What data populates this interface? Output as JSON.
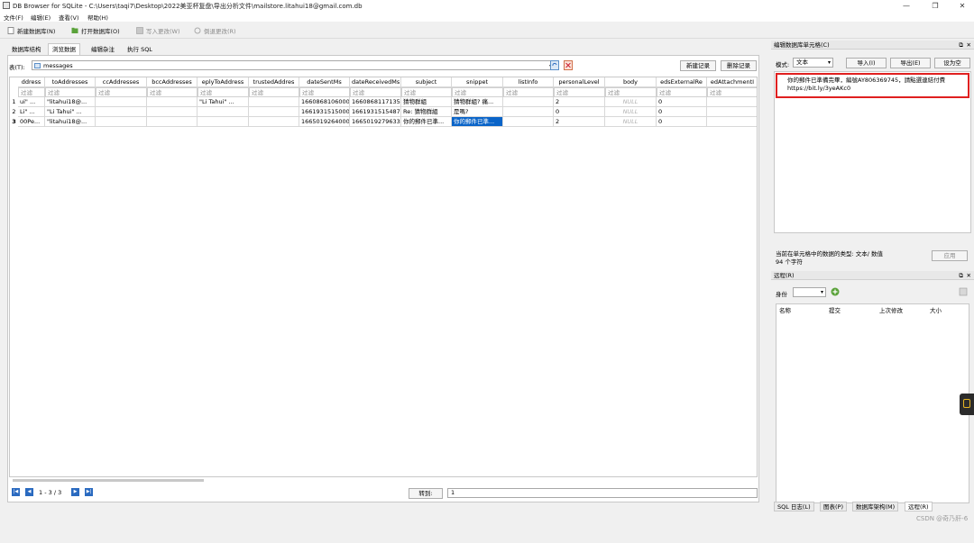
{
  "window": {
    "title": "DB Browser for SQLite - C:\\Users\\taqi7\\Desktop\\2022美亚杯复盘\\导出分析文件\\mailstore.litahui18@gmail.com.db",
    "minimize": "—",
    "maximize": "❐",
    "close": "✕"
  },
  "menu": [
    "文件(F)",
    "编辑(E)",
    "查看(V)",
    "帮助(H)"
  ],
  "toolbar": {
    "new_db": "新建数据库(N)",
    "open_db": "打开数据库(O)",
    "write_changes": "写入更改(W)",
    "revert_changes": "倒退更改(R)"
  },
  "tabs": [
    "数据库结构",
    "浏览数据",
    "编辑杂注",
    "执行 SQL"
  ],
  "active_tab": 1,
  "browse": {
    "table_label": "表(T):",
    "table_name": "messages",
    "new_record": "新建记录",
    "delete_record": "删除记录",
    "filter_placeholder": "过滤",
    "columns": [
      "ddress",
      "toAddresses",
      "ccAddresses",
      "bccAddresses",
      "eplyToAddress",
      "trustedAddres",
      "dateSentMs",
      "dateReceivedMs",
      "subject",
      "snippet",
      "listInfo",
      "personalLevel",
      "body",
      "edsExternalRe",
      "edAttachmentI",
      ""
    ],
    "rows": [
      {
        "num": "1",
        "cells": [
          "ui\" ...",
          "\"litahui18@...",
          "",
          "",
          "\"Li Tahui\" ...",
          "",
          "1660868106000",
          "1660868117135",
          "猜物群組",
          "猜物群組? 痛...",
          "",
          "2",
          "NULL",
          "0",
          "",
          "0"
        ]
      },
      {
        "num": "2",
        "cells": [
          "Li\" ...",
          "\"Li Tahui\" ...",
          "",
          "",
          "",
          "",
          "1661931515000",
          "1661931515487",
          "Re: 猜物群組",
          "是嗎?",
          "",
          "0",
          "NULL",
          "0",
          "",
          "0"
        ]
      },
      {
        "num": "3",
        "cells": [
          "00Pe...",
          "\"litahui18@...",
          "",
          "",
          "",
          "",
          "1665019264000",
          "1665019279633",
          "你的郵件已準...",
          "你的郵件已準...",
          "",
          "2",
          "NULL",
          "0",
          "",
          "1"
        ]
      }
    ],
    "null_text": "NULL",
    "pager": "1 - 3 / 3",
    "goto_label": "转到:",
    "goto_value": "1"
  },
  "edit_cell": {
    "title": "编辑数据库单元格(C)",
    "mode_label": "模式:",
    "mode_value": "文本",
    "import": "导入(I)",
    "export": "导出(E)",
    "set_null": "设为空",
    "content": "你的郵件已準備完畢，編號AY806369745，請點選連結付費 https://bit.ly/3yeAKc0",
    "type_info": "当前在单元格中的数据的类型: 文本/ 数值",
    "char_count": "94 个字符",
    "apply": "应用"
  },
  "remote": {
    "title": "远程(R)",
    "identity_label": "身份",
    "columns": [
      "名称",
      "提交",
      "上次修改",
      "大小"
    ]
  },
  "bottom_tabs": [
    "SQL 日志(L)",
    "图表(P)",
    "数据库架构(M)",
    "远程(R)"
  ],
  "active_bottom_tab": 3,
  "watermark": "CSDN @奇乃肝-6",
  "colors": {
    "accent": "#0a64c8",
    "highlight_border": "#e02020"
  }
}
